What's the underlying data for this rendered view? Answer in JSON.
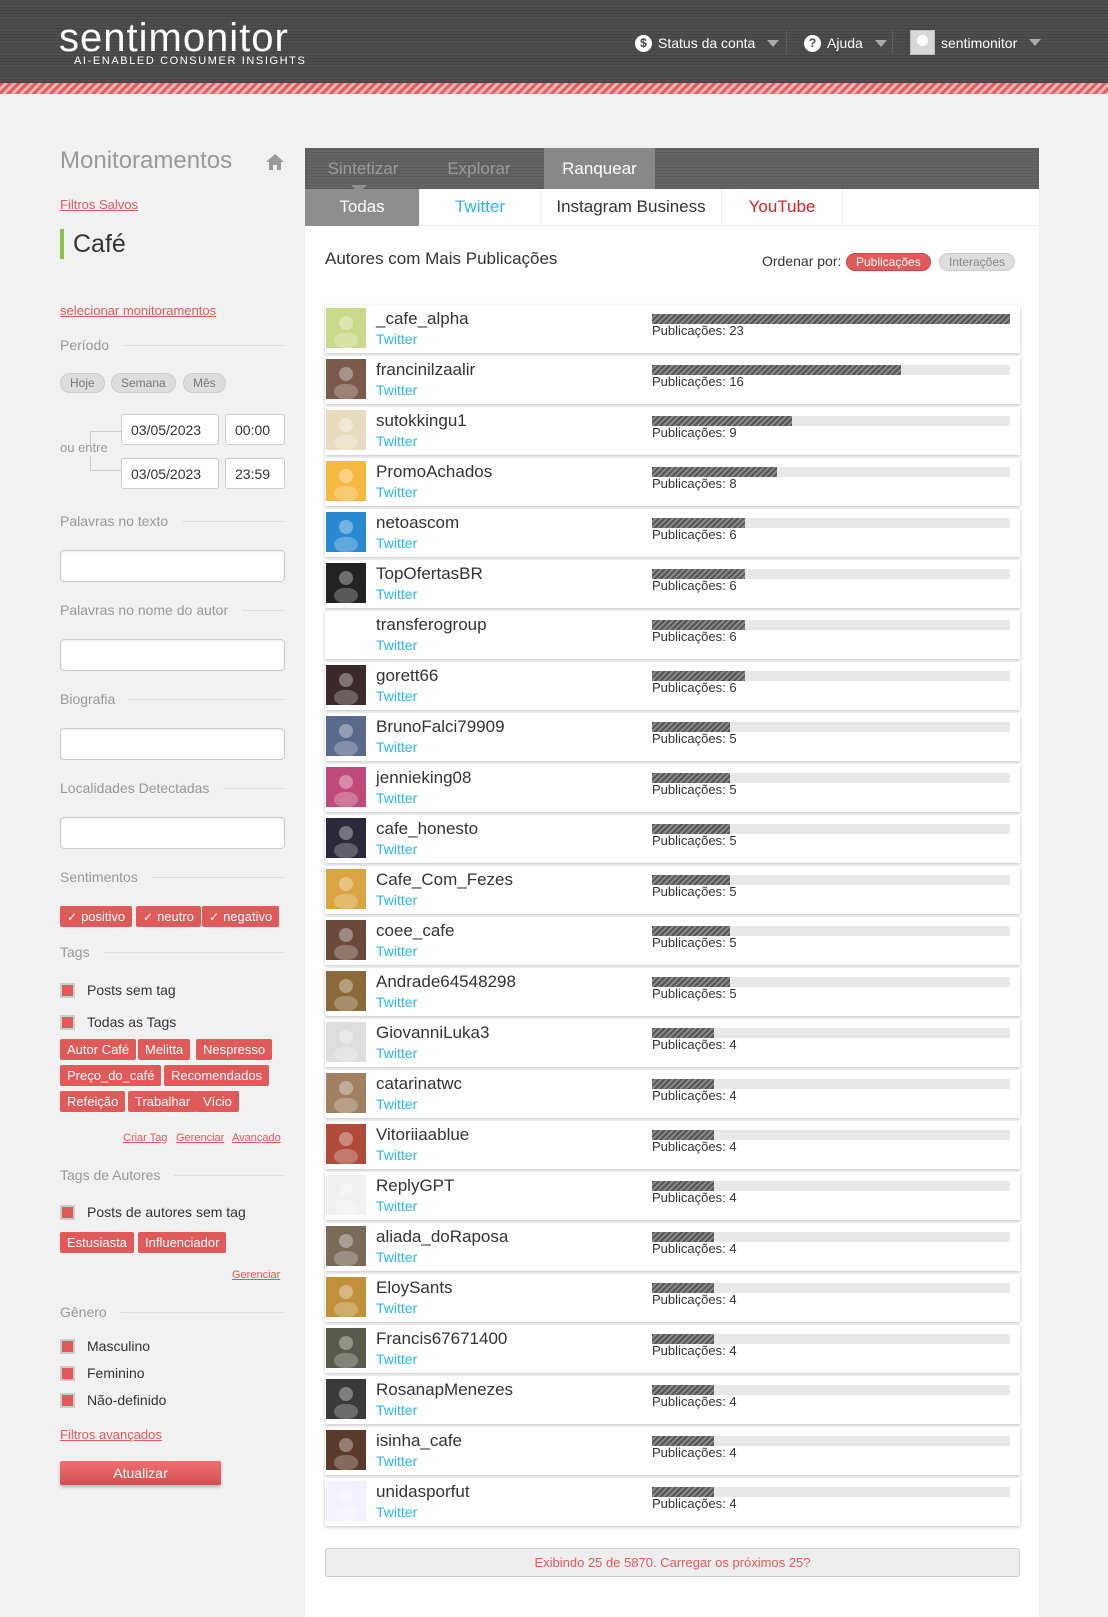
{
  "header": {
    "logo": "sentimonitor",
    "tagline": "AI-ENABLED CONSUMER INSIGHTS",
    "account_status": "Status da conta",
    "help": "Ajuda",
    "username": "sentimonitor"
  },
  "sidebar": {
    "title": "Monitoramentos",
    "saved_filters": "Filtros Salvos",
    "monitor_name": "Café",
    "select_monitors": "selecionar monitoramentos",
    "period_label": "Período",
    "period_buttons": [
      "Hoje",
      "Semana",
      "Mês"
    ],
    "or_between": "ou entre",
    "date_from": "03/05/2023",
    "time_from": "00:00",
    "date_to": "03/05/2023",
    "time_to": "23:59",
    "words_text_label": "Palavras no texto",
    "words_author_label": "Palavras no nome do autor",
    "bio_label": "Biografia",
    "locations_label": "Localidades Detectadas",
    "sentiments_label": "Sentimentos",
    "sentiments": [
      "positivo",
      "neutro",
      "negativo"
    ],
    "tags_label": "Tags",
    "posts_no_tag": "Posts sem tag",
    "all_tags": "Todas as Tags",
    "tags": [
      "Autor Café",
      "Melitta",
      "Nespresso",
      "Preço_do_café",
      "Recomendados",
      "Refeição",
      "Trabalhar",
      "Vício"
    ],
    "create_tag": "Criar Tag",
    "manage": "Gerenciar",
    "advanced": "Avançado",
    "author_tags_label": "Tags de Autores",
    "posts_authors_no_tag": "Posts de autores sem tag",
    "author_tags": [
      "Estusiasta",
      "Influenciador"
    ],
    "manage2": "Gerenciar",
    "gender_label": "Gênero",
    "genders": [
      "Masculino",
      "Feminino",
      "Não-definido"
    ],
    "advanced_filters": "Filtros avançados",
    "update_button": "Atualizar"
  },
  "main": {
    "nav_tabs": [
      "Sintetizar",
      "Explorar",
      "Ranquear"
    ],
    "sub_tabs": [
      "Todas",
      "Twitter",
      "Instagram Business",
      "YouTube"
    ],
    "list_title": "Autores com Mais Publicações",
    "order_by": "Ordenar por:",
    "order_publications": "Publicações",
    "order_interactions": "Interações",
    "load_more": "Exibindo 25 de 5870. Carregar os próximos 25?"
  },
  "authors": [
    {
      "name": "_cafe_alpha",
      "source": "Twitter",
      "count_label": "Publicações: 23",
      "count": 23,
      "color": "#c9d98a"
    },
    {
      "name": "francinilzaalir",
      "source": "Twitter",
      "count_label": "Publicações: 16",
      "count": 16,
      "color": "#7a5a4a"
    },
    {
      "name": "sutokkingu1",
      "source": "Twitter",
      "count_label": "Publicações: 9",
      "count": 9,
      "color": "#e8dcc0"
    },
    {
      "name": "PromoAchados",
      "source": "Twitter",
      "count_label": "Publicações: 8",
      "count": 8,
      "color": "#f5b942"
    },
    {
      "name": "netoascom",
      "source": "Twitter",
      "count_label": "Publicações: 6",
      "count": 6,
      "color": "#2a8ad1"
    },
    {
      "name": "TopOfertasBR",
      "source": "Twitter",
      "count_label": "Publicações: 6",
      "count": 6,
      "color": "#222222"
    },
    {
      "name": "transferogroup",
      "source": "Twitter",
      "count_label": "Publicações: 6",
      "count": 6,
      "color": "#ffffff"
    },
    {
      "name": "gorett66",
      "source": "Twitter",
      "count_label": "Publicações: 6",
      "count": 6,
      "color": "#3a2a2a"
    },
    {
      "name": "BrunoFalci79909",
      "source": "Twitter",
      "count_label": "Publicações: 5",
      "count": 5,
      "color": "#5a6a8a"
    },
    {
      "name": "jennieking08",
      "source": "Twitter",
      "count_label": "Publicações: 5",
      "count": 5,
      "color": "#c04a7a"
    },
    {
      "name": "cafe_honesto",
      "source": "Twitter",
      "count_label": "Publicações: 5",
      "count": 5,
      "color": "#2a2a3a"
    },
    {
      "name": "Cafe_Com_Fezes",
      "source": "Twitter",
      "count_label": "Publicações: 5",
      "count": 5,
      "color": "#d9a441"
    },
    {
      "name": "coee_cafe",
      "source": "Twitter",
      "count_label": "Publicações: 5",
      "count": 5,
      "color": "#6a4a3a"
    },
    {
      "name": "Andrade64548298",
      "source": "Twitter",
      "count_label": "Publicações: 5",
      "count": 5,
      "color": "#8a6a3a"
    },
    {
      "name": "GiovanniLuka3",
      "source": "Twitter",
      "count_label": "Publicações: 4",
      "count": 4,
      "color": "#dddddd"
    },
    {
      "name": "catarinatwc",
      "source": "Twitter",
      "count_label": "Publicações: 4",
      "count": 4,
      "color": "#a08060"
    },
    {
      "name": "Vitoriiaablue",
      "source": "Twitter",
      "count_label": "Publicações: 4",
      "count": 4,
      "color": "#b04a3a"
    },
    {
      "name": "ReplyGPT",
      "source": "Twitter",
      "count_label": "Publicações: 4",
      "count": 4,
      "color": "#f0f0f0"
    },
    {
      "name": "aliada_doRaposa",
      "source": "Twitter",
      "count_label": "Publicações: 4",
      "count": 4,
      "color": "#7a6a5a"
    },
    {
      "name": "EloySants",
      "source": "Twitter",
      "count_label": "Publicações: 4",
      "count": 4,
      "color": "#c0903a"
    },
    {
      "name": "Francis67671400",
      "source": "Twitter",
      "count_label": "Publicações: 4",
      "count": 4,
      "color": "#5a5a4a"
    },
    {
      "name": "RosanapMenezes",
      "source": "Twitter",
      "count_label": "Publicações: 4",
      "count": 4,
      "color": "#3a3a3a"
    },
    {
      "name": "isinha_cafe",
      "source": "Twitter",
      "count_label": "Publicações: 4",
      "count": 4,
      "color": "#5a3a2a"
    },
    {
      "name": "unidasporfut",
      "source": "Twitter",
      "count_label": "Publicações: 4",
      "count": 4,
      "color": "#f4f0ff"
    }
  ],
  "colors": {
    "accent": "#e05a5a",
    "twitter": "#29b6f6",
    "youtube": "#e02020",
    "green_marker": "#8bc34a"
  }
}
